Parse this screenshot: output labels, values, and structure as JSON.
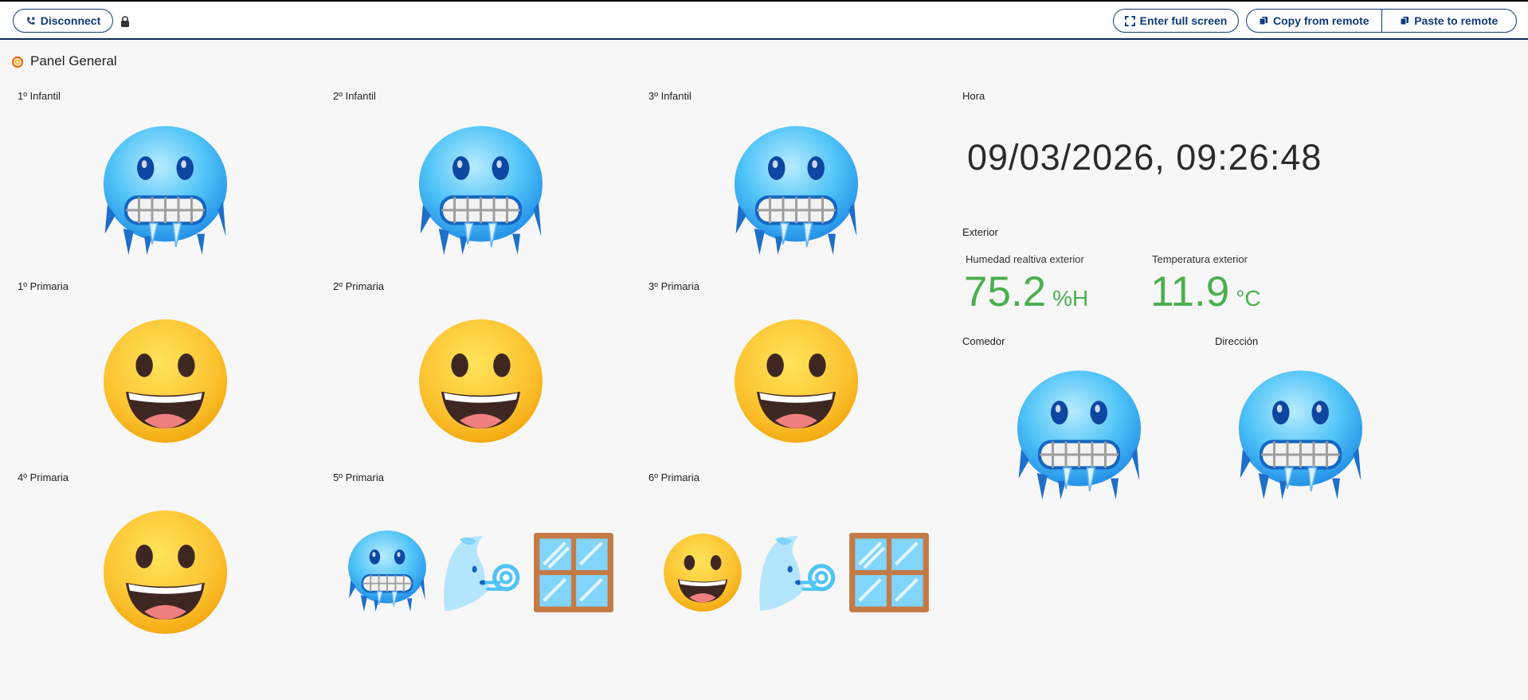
{
  "toolbar": {
    "disconnect_label": "Disconnect",
    "fullscreen_label": "Enter full screen",
    "copy_label": "Copy from remote",
    "paste_label": "Paste to remote"
  },
  "panel": {
    "title": "Panel General"
  },
  "classrooms": [
    {
      "label": "1º Infantil",
      "icons": [
        "cold-face-icon"
      ]
    },
    {
      "label": "2º Infantil",
      "icons": [
        "cold-face-icon"
      ]
    },
    {
      "label": "3º Infantil",
      "icons": [
        "cold-face-icon"
      ]
    },
    {
      "label": "1º Primaria",
      "icons": [
        "grinning-face-icon"
      ]
    },
    {
      "label": "2º Primaria",
      "icons": [
        "grinning-face-icon"
      ]
    },
    {
      "label": "3º Primaria",
      "icons": [
        "grinning-face-icon"
      ]
    },
    {
      "label": "4º Primaria",
      "icons": [
        "grinning-face-icon"
      ]
    },
    {
      "label": "5º Primaria",
      "icons": [
        "cold-face-icon",
        "wind-face-icon",
        "window-icon"
      ]
    },
    {
      "label": "6º Primaria",
      "icons": [
        "grinning-face-icon",
        "wind-face-icon",
        "window-icon"
      ]
    }
  ],
  "hora": {
    "label": "Hora",
    "value": "09/03/2026, 09:26:48"
  },
  "exterior": {
    "label": "Exterior",
    "humidity": {
      "label": "Humedad realtiva exterior",
      "value": "75.2",
      "unit": "%H"
    },
    "temperature": {
      "label": "Temperatura exterior",
      "value": "11.9",
      "unit": "°C"
    }
  },
  "comedor": {
    "label": "Comedor",
    "icons": [
      "cold-face-icon"
    ]
  },
  "direccion": {
    "label": "Dirección",
    "icons": [
      "cold-face-icon"
    ]
  },
  "colors": {
    "accent": "#0f3b78",
    "value_green": "#4caf50"
  }
}
